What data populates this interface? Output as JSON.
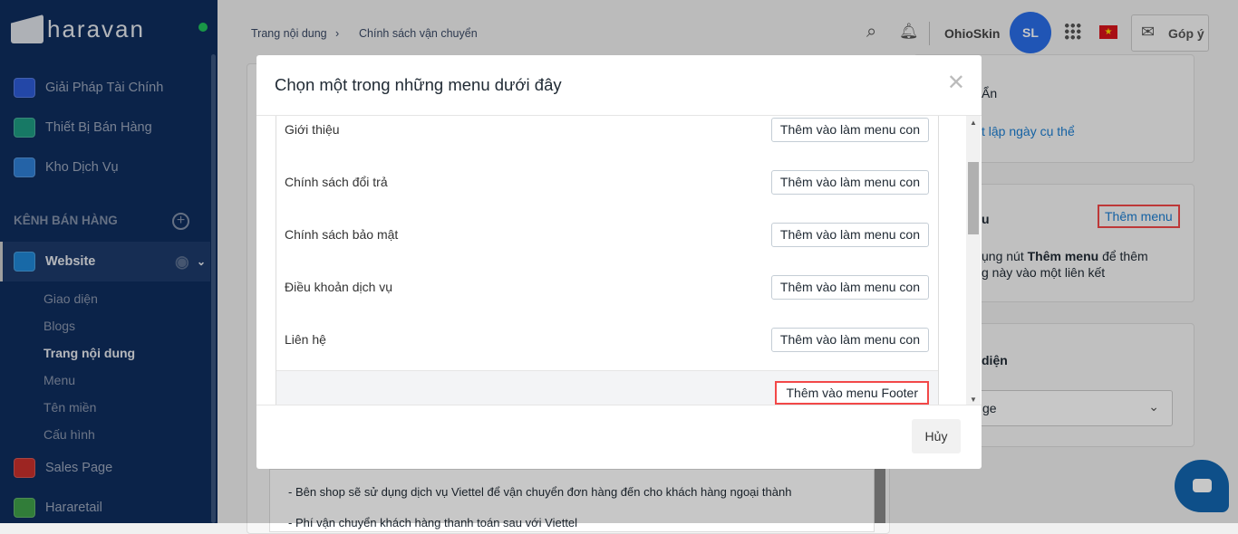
{
  "sidebar": {
    "logo": "haravan",
    "items": [
      {
        "label": "Giải Pháp Tài Chính",
        "color": "#2d5bd6"
      },
      {
        "label": "Thiết Bị Bán Hàng",
        "color": "#1e9b82"
      },
      {
        "label": "Kho Dịch Vụ",
        "color": "#2f7fd6"
      }
    ],
    "section": "KÊNH BÁN HÀNG",
    "website": "Website",
    "subitems": [
      "Giao diện",
      "Blogs",
      "Trang nội dung",
      "Menu",
      "Tên miền",
      "Cấu hình"
    ],
    "others": [
      {
        "label": "Sales Page",
        "color": "#c9302c"
      },
      {
        "label": "Hararetail",
        "color": "#3fa14a"
      }
    ]
  },
  "header": {
    "breadcrumb": [
      "Trang nội dung",
      "Chính sách vận chuyển"
    ],
    "store": "OhioSkin",
    "avatar": "SL",
    "feedback": "Góp ý"
  },
  "right": {
    "visibility": "Ẩn",
    "set_date": "t lập ngày cụ thể",
    "menu_title": "u",
    "add_menu": "Thêm menu",
    "hint_pre": "ụng nút ",
    "hint_bold": "Thêm menu",
    "hint_post": " để thêm",
    "hint2": "g này vào một liên kết",
    "template_title": "diện",
    "template_value": "ge"
  },
  "content": {
    "lines": [
      "- Bên shop sẽ sử dụng dịch vụ Viettel để vận chuyển đơn hàng đến cho khách hàng ngoại thành",
      "- Phí vận chuyển khách hàng thanh toán sau với Viettel"
    ]
  },
  "modal": {
    "title": "Chọn một trong những menu dưới đây",
    "rows": [
      "Giới thiệu",
      "Chính sách đổi trả",
      "Chính sách bảo mật",
      "Điều khoản dịch vụ",
      "Liên hệ"
    ],
    "row_button": "Thêm vào làm menu con",
    "footer_button": "Thêm vào menu Footer",
    "cancel": "Hủy"
  }
}
